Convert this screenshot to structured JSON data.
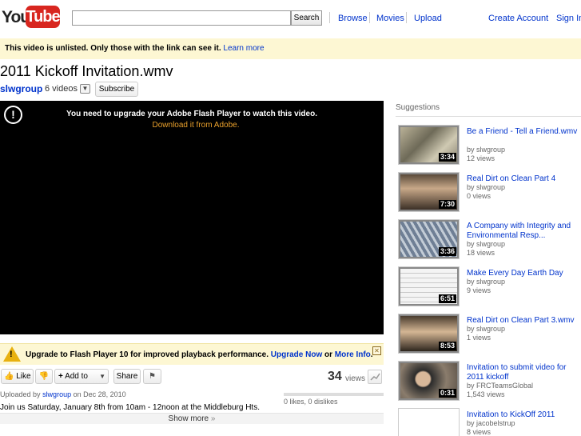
{
  "header": {
    "logo_you": "You",
    "logo_tube": "Tube",
    "search_placeholder": "",
    "search_button": "Search",
    "nav": [
      "Browse",
      "Movies",
      "Upload"
    ],
    "create_account": "Create Account",
    "sign_in": "Sign In"
  },
  "notice": {
    "text": "This video is unlisted. Only those with the link can see it.",
    "link": "Learn more"
  },
  "video": {
    "title": "2011 Kickoff Invitation.wmv",
    "channel": "slwgroup",
    "videos_count": "6 videos",
    "subscribe": "Subscribe"
  },
  "player": {
    "message": "You need to upgrade your Adobe Flash Player to watch this video.",
    "download_link": "Download it from Adobe."
  },
  "upgrade": {
    "text": "Upgrade to Flash Player 10 for improved playback performance.",
    "upgrade_now": "Upgrade Now",
    "or": "or",
    "more_info": "More Info",
    "period": "."
  },
  "actions": {
    "like": "Like",
    "add_to": "Add to",
    "share": "Share",
    "views_count": "34",
    "views_label": "views"
  },
  "meta": {
    "uploaded_prefix": "Uploaded by",
    "uploader": "slwgroup",
    "uploaded_date": "on Dec 28, 2010",
    "likes": "0 likes, 0 dislikes",
    "description": "Join us Saturday, January 8th from 10am - 12noon at the Middleburg Hts.",
    "show_more": "Show more"
  },
  "suggestions": {
    "title": "Suggestions",
    "items": [
      {
        "title": "Be a Friend - Tell a Friend.wmv",
        "by": "by slwgroup",
        "views": "12 views",
        "duration": "3:34"
      },
      {
        "title": "Real Dirt on Clean Part 4",
        "by": "by slwgroup",
        "views": "0 views",
        "duration": "7:30"
      },
      {
        "title": "A Company with Integrity and Environmental Resp...",
        "by": "by slwgroup",
        "views": "18 views",
        "duration": "3:36"
      },
      {
        "title": "Make Every Day Earth Day",
        "by": "by slwgroup",
        "views": "9 views",
        "duration": "6:51"
      },
      {
        "title": "Real Dirt on Clean Part 3.wmv",
        "by": "by slwgroup",
        "views": "1 views",
        "duration": "8:53"
      },
      {
        "title": "Invitation to submit video for 2011 kickoff",
        "by": "by FRCTeamsGlobal",
        "views": "1,543 views",
        "duration": "0:31"
      },
      {
        "title": "Invitation to KickOff 2011",
        "by": "by jacobelstrup",
        "views": "8 views",
        "duration": ""
      }
    ]
  },
  "colors": {
    "brand_red": "#d8261f",
    "link_blue": "#0033cc",
    "notice_bg": "#fdf7d3",
    "flash_link": "#e9a02c"
  }
}
